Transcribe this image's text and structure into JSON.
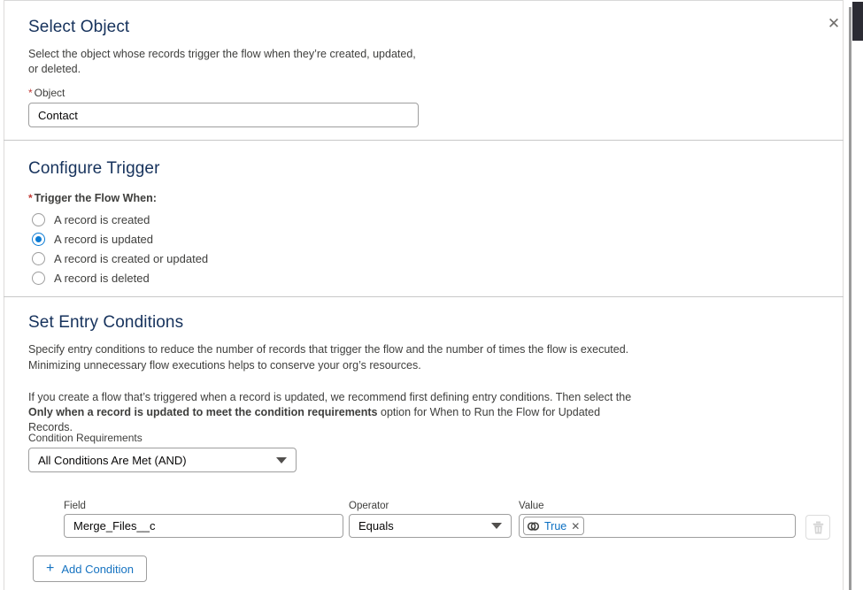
{
  "window": {
    "close_label": "✕"
  },
  "select_object": {
    "title": "Select Object",
    "description": "Select the object whose records trigger the flow when they’re created, updated, or deleted.",
    "object_label": "Object",
    "object_required_mark": "*",
    "object_value": "Contact"
  },
  "configure_trigger": {
    "title": "Configure Trigger",
    "group_required_mark": "*",
    "group_label": "Trigger the Flow When:",
    "options": [
      {
        "label": "A record is created",
        "selected": false
      },
      {
        "label": "A record is updated",
        "selected": true
      },
      {
        "label": "A record is created or updated",
        "selected": false
      },
      {
        "label": "A record is deleted",
        "selected": false
      }
    ]
  },
  "entry_conditions": {
    "title": "Set Entry Conditions",
    "description_line1": "Specify entry conditions to reduce the number of records that trigger the flow and the number of times the flow is executed.",
    "description_line2": "Minimizing unnecessary flow executions helps to conserve your org’s resources.",
    "recommendation_prefix": "If you create a flow that’s triggered when a record is updated, we recommend first defining entry conditions. Then select the ",
    "recommendation_bold": "Only when a record is updated to meet the condition requirements",
    "recommendation_suffix": " option for When to Run the Flow for Updated Records.",
    "requirements_label": "Condition Requirements",
    "requirements_value": "All Conditions Are Met (AND)",
    "columns": {
      "field": "Field",
      "operator": "Operator",
      "value": "Value"
    },
    "rows": [
      {
        "field": "Merge_Files__c",
        "operator": "Equals",
        "value_pill": "True",
        "value_pill_remove": "✕"
      }
    ],
    "add_condition_label": "Add Condition",
    "add_condition_icon": "+"
  },
  "colors": {
    "accent_blue": "#0b7bd4",
    "link_blue": "#1673c1",
    "required_red": "#c23934",
    "border_gray": "#9e9e9e",
    "divider_gray": "#c8c8c8",
    "text_dark": "#3e3e3c",
    "heading": "#16325c",
    "scroll_thumb": "#2b2b33"
  }
}
